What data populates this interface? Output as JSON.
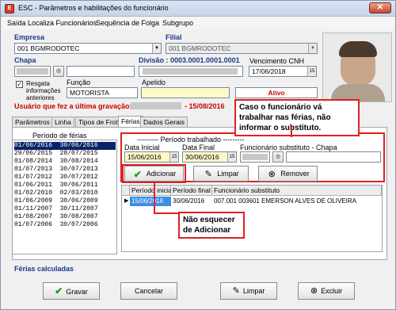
{
  "window": {
    "title": "ESC - Parâmetros e habilitações do funcionário",
    "close": "✕"
  },
  "menu": [
    "Saída",
    "Localiza Funcionários",
    "Sequência de Folga",
    "Subgrupo"
  ],
  "empresa": {
    "label": "Empresa",
    "value": "001 BGMRODOTEC"
  },
  "filial": {
    "label": "Filial",
    "value": "001 BGMRODOTEC"
  },
  "chapa": {
    "label": "Chapa"
  },
  "divisao": {
    "label": "Divisão : 0003.0001.0001.0001"
  },
  "vencimento": {
    "label": "Vencimento CNH",
    "value": "17/06/2018"
  },
  "resgata": {
    "label": "Resgata informações anteriores",
    "checked": true
  },
  "funcao": {
    "label": "Função",
    "value": "MOTORISTA"
  },
  "apelido": {
    "label": "Apelido"
  },
  "status": {
    "value": "Ativo"
  },
  "ultima_gravacao": {
    "label": "Usuário que fez a última gravação:",
    "date": "- 15/08/2016"
  },
  "tabs": [
    "Parâmetros",
    "Linha",
    "Tipos de Frota",
    "Férias",
    "Dados Gerais"
  ],
  "periodo_ferias": {
    "label": "Período de férias",
    "rows": [
      [
        "01/06/2016",
        "30/06/2016"
      ],
      [
        "29/06/2015",
        "28/07/2015"
      ],
      [
        "01/08/2014",
        "30/08/2014"
      ],
      [
        "01/07/2013",
        "30/07/2013"
      ],
      [
        "01/07/2012",
        "30/07/2012"
      ],
      [
        "01/06/2011",
        "30/06/2011"
      ],
      [
        "01/02/2010",
        "02/03/2010"
      ],
      [
        "01/06/2009",
        "30/06/2009"
      ],
      [
        "01/11/2007",
        "30/11/2007"
      ],
      [
        "01/08/2007",
        "30/08/2007"
      ],
      [
        "01/07/2006",
        "30/07/2006"
      ]
    ]
  },
  "periodo_trabalhado": {
    "label": "--------- Período trabalhado ---------",
    "data_inicial_label": "Data Inicial",
    "data_inicial": "15/06/2016",
    "data_final_label": "Data Final",
    "data_final": "30/06/2016",
    "substituto_label": "Funcionário substituto - Chapa"
  },
  "buttons": {
    "adicionar": "Adicionar",
    "limpar": "Limpar",
    "remover": "Remover"
  },
  "grid": {
    "headers": [
      "Período inicial",
      "Período final",
      "Funcionário substituto"
    ],
    "row": [
      "15/06/2016",
      "30/06/2016",
      "007.001 003601 EMERSON ALVES DE OLIVEIRA"
    ]
  },
  "callouts": {
    "substituto": "Caso o funcionário vá trabalhar nas férias, não informar o substituto.",
    "adicionar": "Não esquecer de Adicionar"
  },
  "ferias_calculadas": "Férias calculadas",
  "bottom": {
    "gravar": "Gravar",
    "cancelar": "Cancelar",
    "limpar": "Limpar",
    "excluir": "Excluir"
  },
  "colors": {
    "accent_blue": "#1a3a8a",
    "red": "#e02020",
    "status_red": "#cc0000",
    "highlight": "#fff9c8"
  }
}
